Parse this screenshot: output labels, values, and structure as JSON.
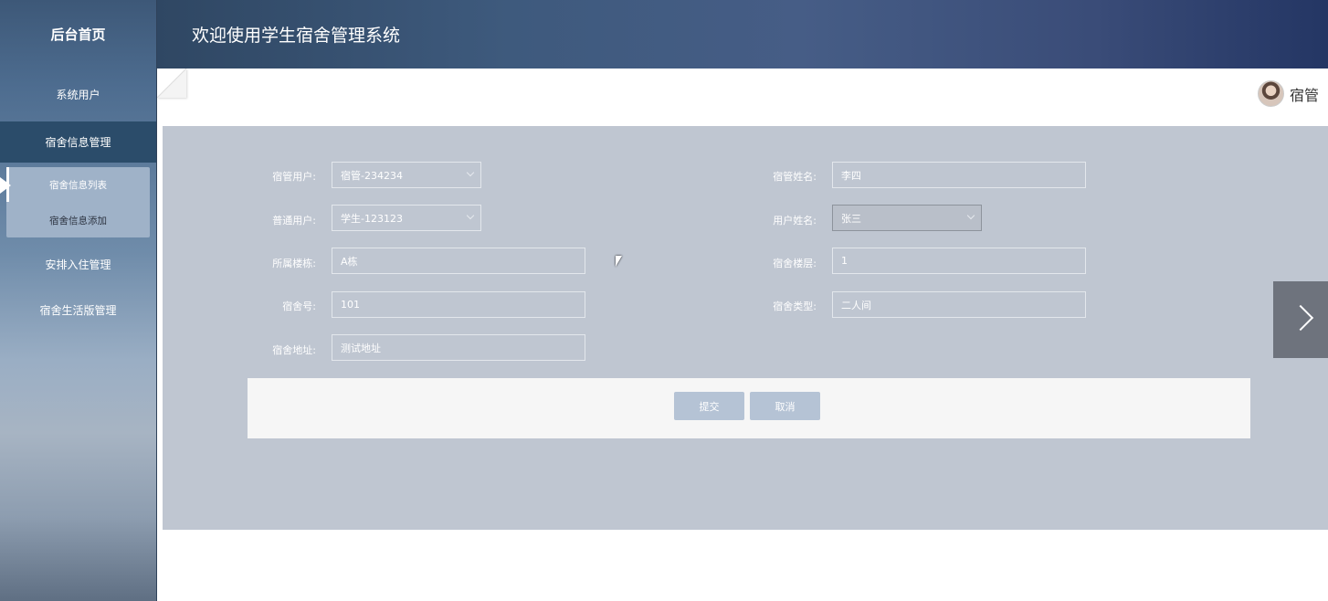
{
  "sidebar": {
    "home": "后台首页",
    "items": [
      {
        "label": "系统用户"
      },
      {
        "label": "宿舍信息管理"
      },
      {
        "label": "安排入住管理"
      },
      {
        "label": "宿舍生活版管理"
      }
    ],
    "submenu": [
      {
        "label": "宿舍信息列表"
      },
      {
        "label": "宿舍信息添加"
      }
    ]
  },
  "header": {
    "title": "欢迎使用学生宿舍管理系统"
  },
  "user": {
    "name": "宿管"
  },
  "form": {
    "manager_user": {
      "label": "宿管用户:",
      "value": "宿管-234234"
    },
    "manager_name": {
      "label": "宿管姓名:",
      "value": "李四"
    },
    "normal_user": {
      "label": "普通用户:",
      "value": "学生-123123"
    },
    "user_name": {
      "label": "用户姓名:",
      "value": "张三"
    },
    "building": {
      "label": "所属楼栋:",
      "value": "A栋"
    },
    "floor": {
      "label": "宿舍楼层:",
      "value": "1"
    },
    "room_no": {
      "label": "宿舍号:",
      "value": "101"
    },
    "room_type": {
      "label": "宿舍类型:",
      "value": "二人间"
    },
    "address": {
      "label": "宿舍地址:",
      "value": "测试地址"
    },
    "submit": "提交",
    "cancel": "取消"
  }
}
